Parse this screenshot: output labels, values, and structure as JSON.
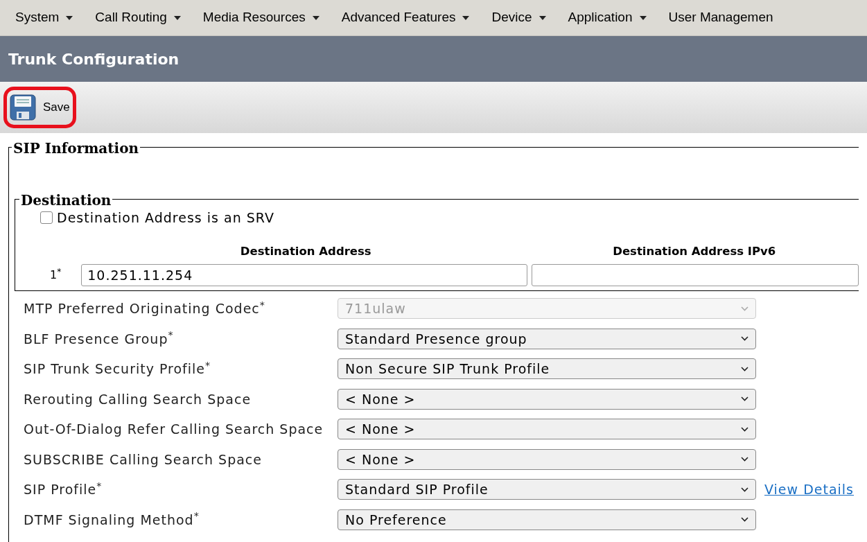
{
  "menu": [
    {
      "label": "System",
      "caret": true
    },
    {
      "label": "Call Routing",
      "caret": true
    },
    {
      "label": "Media Resources",
      "caret": true
    },
    {
      "label": "Advanced Features",
      "caret": true
    },
    {
      "label": "Device",
      "caret": true
    },
    {
      "label": "Application",
      "caret": true
    },
    {
      "label": "User Managemen",
      "caret": false
    }
  ],
  "page_title": "Trunk Configuration",
  "toolbar": {
    "save": {
      "label": "Save",
      "highlighted": true
    }
  },
  "sip_information": {
    "legend": "SIP Information",
    "destination": {
      "legend": "Destination",
      "srv_checkbox": {
        "label": "Destination Address is an SRV",
        "checked": false
      },
      "columns": [
        "Destination Address",
        "Destination Address IPv6"
      ],
      "rows": [
        {
          "index": "1$^{*}$",
          "address": "10.251.11.254",
          "address_ipv6": ""
        }
      ]
    },
    "fields": [
      {
        "label": "MTP Preferred Originating Codec$^{*}$",
        "value": "711ulaw",
        "disabled": true
      },
      {
        "label": "BLF Presence Group$^{*}$",
        "value": "Standard Presence group",
        "disabled": false
      },
      {
        "label": "SIP Trunk Security Profile$^{*}$",
        "value": "Non Secure SIP Trunk Profile",
        "disabled": false
      },
      {
        "label": "Rerouting Calling Search Space",
        "value": "< None >",
        "disabled": false
      },
      {
        "label": "Out-Of-Dialog Refer Calling Search Space",
        "value": "< None >",
        "disabled": false
      },
      {
        "label": "SUBSCRIBE Calling Search Space",
        "value": "< None >",
        "disabled": false
      },
      {
        "label": "SIP Profile$^{*}$",
        "value": "Standard SIP Profile",
        "disabled": false,
        "link": "View Details"
      },
      {
        "label": "DTMF Signaling Method$^{*}$",
        "value": "No Preference",
        "disabled": false
      }
    ]
  }
}
